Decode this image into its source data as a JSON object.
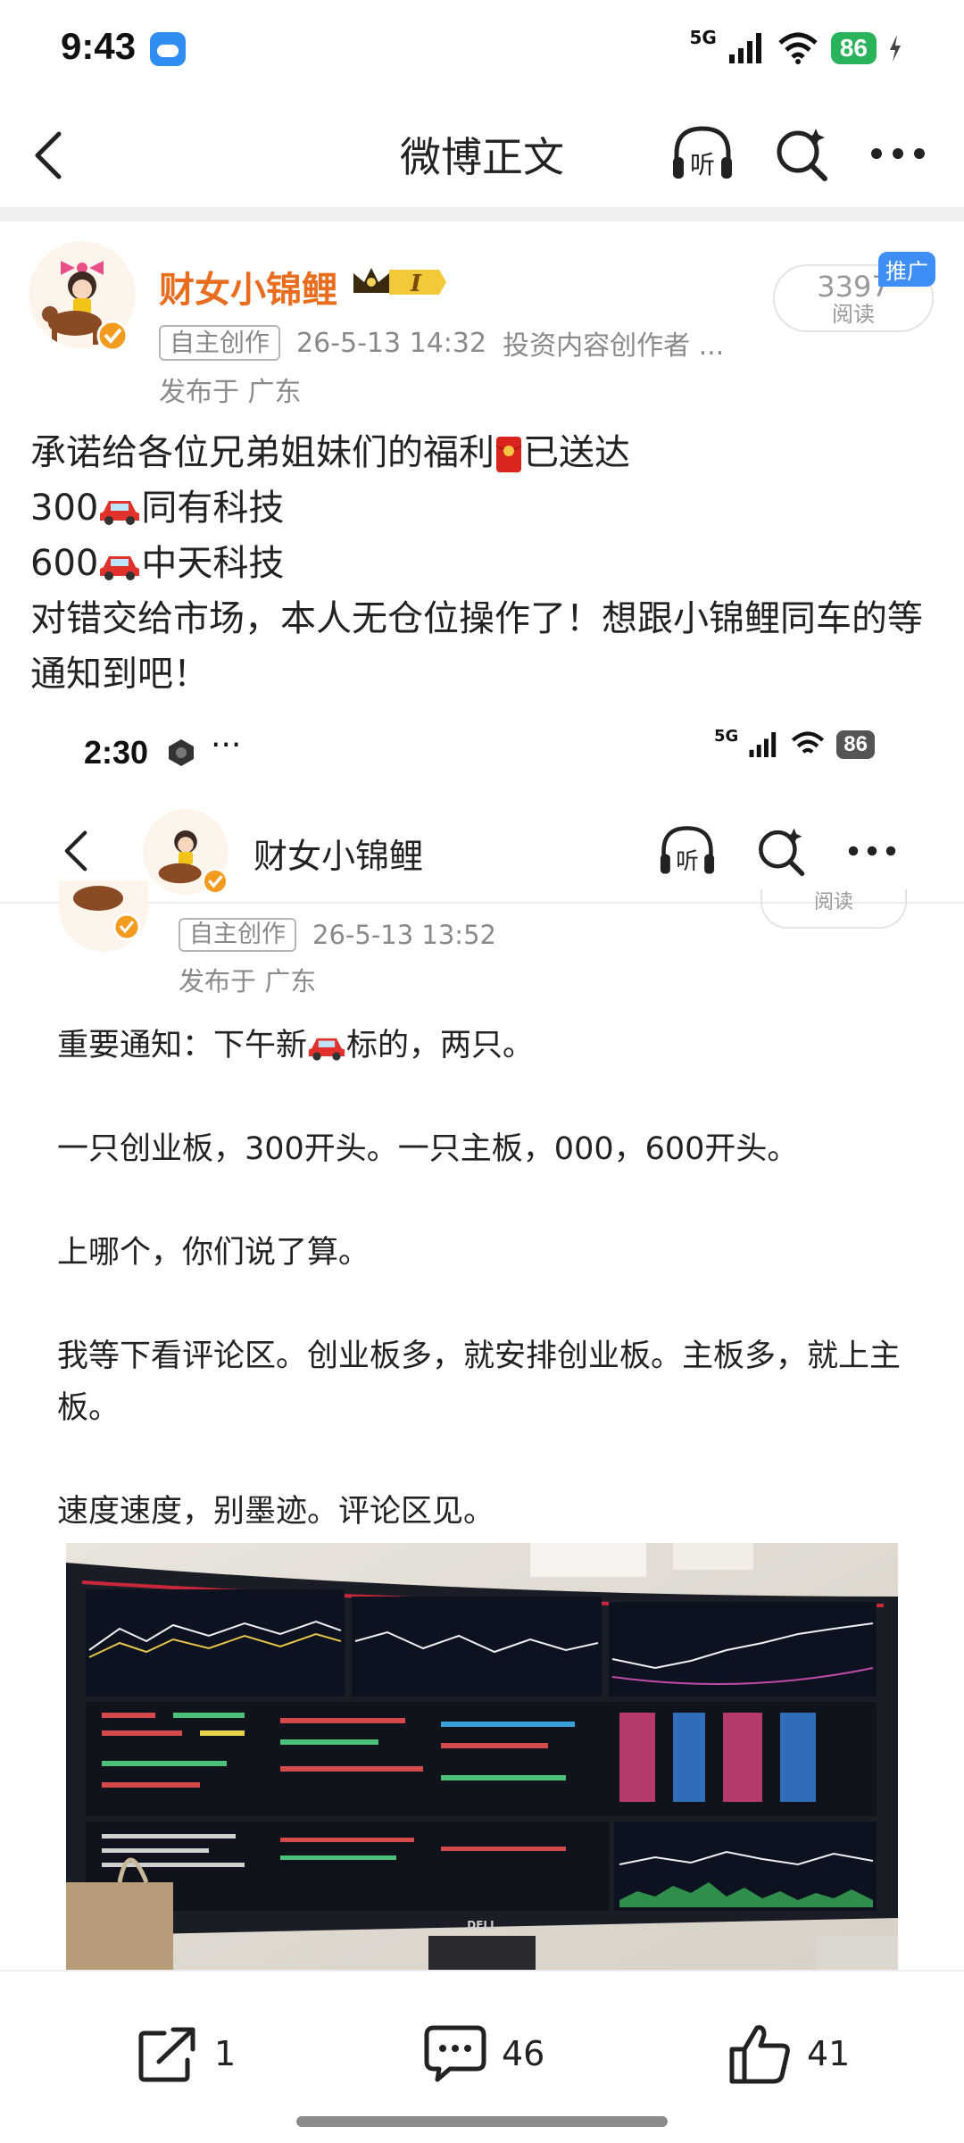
{
  "status_bar": {
    "time": "9:43",
    "network": "5G",
    "battery": "86"
  },
  "nav": {
    "title": "微博正文",
    "listen_icon_char": "听"
  },
  "author": {
    "name": "财女小锦鲤",
    "level_badge": "I",
    "tag": "自主创作",
    "datetime": "26-5-13 14:32",
    "identity": "投资内容创作者 ...",
    "location": "发布于 广东"
  },
  "read": {
    "count": "3397",
    "label": "阅读",
    "promo": "推广"
  },
  "post": {
    "line1_a": "承诺给各位兄弟姐妹们的福利",
    "line1_b": "已送达",
    "line2_code": "300",
    "line2_name": "同有科技",
    "line3_code": "600",
    "line3_name": "中天科技",
    "line4": "对错交给市场，本人无仓位操作了！想跟小锦鲤同车的等通知到吧！"
  },
  "embedded": {
    "status_time": "2:30",
    "status_dots": "···",
    "network": "5G",
    "battery": "86",
    "author_name": "财女小锦鲤",
    "listen_icon_char": "听",
    "read_label": "阅读",
    "tag": "自主创作",
    "datetime": "26-5-13 13:52",
    "location": "发布于 广东",
    "p1_a": "重要通知：下午新",
    "p1_b": "标的，两只。",
    "p2": "一只创业板，300开头。一只主板，000，600开头。",
    "p3": "上哪个，你们说了算。",
    "p4": "我等下看评论区。创业板多，就安排创业板。主板多，就上主板。",
    "p5": "速度速度，别墨迹。评论区见。",
    "monitor_brand": "DELL"
  },
  "actions": {
    "repost_count": "1",
    "comment_count": "46",
    "like_count": "41"
  },
  "colors": {
    "author_name": "#e86d1f",
    "promo_badge": "#3f8ef5",
    "battery": "#29b35a",
    "car": "#e0312c",
    "red_envelope": "#d9251d"
  }
}
